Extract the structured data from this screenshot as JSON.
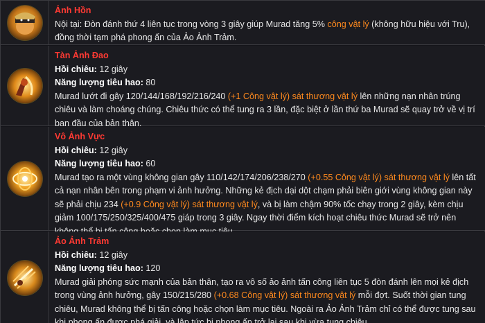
{
  "skills": [
    {
      "title": "Ảnh Hồn",
      "icon": "murad-passive-icon",
      "desc": [
        {
          "t": "Nội tại: Đòn đánh thứ 4 liên tục trong vòng 3 giây giúp Murad tăng 5% ",
          "c": ""
        },
        {
          "t": "công vật lý",
          "c": "orange"
        },
        {
          "t": " (không hữu hiệu với Tru), đồng thời tạm phá phong ấn của Ảo Ảnh Trảm.",
          "c": ""
        }
      ]
    },
    {
      "title": "Tàn Ảnh Đao",
      "icon": "murad-skill1-icon",
      "cooldown_label": "Hồi chiêu:",
      "cooldown": "12 giây",
      "mana_label": "Năng lượng tiêu hao:",
      "mana": "80",
      "desc": [
        {
          "t": "Murad lướt đi gây 120/144/168/192/216/240 ",
          "c": ""
        },
        {
          "t": "(+1 Công vật lý)",
          "c": "orange"
        },
        {
          "t": " ",
          "c": ""
        },
        {
          "t": "sát thương vật lý",
          "c": "orange"
        },
        {
          "t": " lên những nạn nhân trúng chiêu và làm choáng chúng. Chiêu thức có thể tung ra 3 lần, đặc biệt ở lần thứ ba Murad sẽ quay trở về vị trí ban đầu của bản thân.",
          "c": ""
        }
      ]
    },
    {
      "title": "Vô Ảnh Vực",
      "icon": "murad-skill2-icon",
      "cooldown_label": "Hồi chiêu:",
      "cooldown": "12 giây",
      "mana_label": "Năng lượng tiêu hao:",
      "mana": "60",
      "desc": [
        {
          "t": "Murad tạo ra một vùng không gian gây 110/142/174/206/238/270 ",
          "c": ""
        },
        {
          "t": "(+0.55 Công vật lý)",
          "c": "orange"
        },
        {
          "t": " ",
          "c": ""
        },
        {
          "t": "sát thương vật lý",
          "c": "orange"
        },
        {
          "t": " lên tất cả nạn nhân bên trong phạm vi ảnh hưởng. Những kẻ địch dại dột chạm phải biên giới vùng không gian này sẽ phải chịu 234 ",
          "c": ""
        },
        {
          "t": "(+0.9 Công vật lý)",
          "c": "orange"
        },
        {
          "t": " ",
          "c": ""
        },
        {
          "t": "sát thương vật lý",
          "c": "orange"
        },
        {
          "t": ", và bị làm chậm 90% tốc chạy trong 2 giây, kèm chịu giảm 100/175/250/325/400/475 giáp trong 3 giây. Ngay thời điểm kích hoạt chiêu thức Murad sẽ trở nên không thể bị tấn công hoặc chọn làm mục tiêu.",
          "c": ""
        }
      ]
    },
    {
      "title": "Ảo Ảnh Trảm",
      "icon": "murad-ultimate-icon",
      "cooldown_label": "Hồi chiêu:",
      "cooldown": "12 giây",
      "mana_label": "Năng lượng tiêu hao:",
      "mana": "120",
      "desc": [
        {
          "t": "Murad giải phóng sức mạnh của bản thân, tạo ra vô số ảo ảnh tấn công liên tục 5 đòn đánh lên mọi kẻ địch trong vùng ảnh hưởng, gây 150/215/280 ",
          "c": ""
        },
        {
          "t": "(+0.68 Công vật lý)",
          "c": "orange"
        },
        {
          "t": " ",
          "c": ""
        },
        {
          "t": "sát thương vật lý",
          "c": "orange"
        },
        {
          "t": " mỗi đợt. Suốt thời gian tung chiêu, Murad không thể bị tấn công hoặc chọn làm mục tiêu. Ngoài ra Ảo Ảnh Trảm chỉ có thể được tung sau khi phong ấn được phá giải, và lập tức bị phong ấn trở lại sau khi vừa tung chiêu.",
          "c": ""
        }
      ]
    }
  ]
}
